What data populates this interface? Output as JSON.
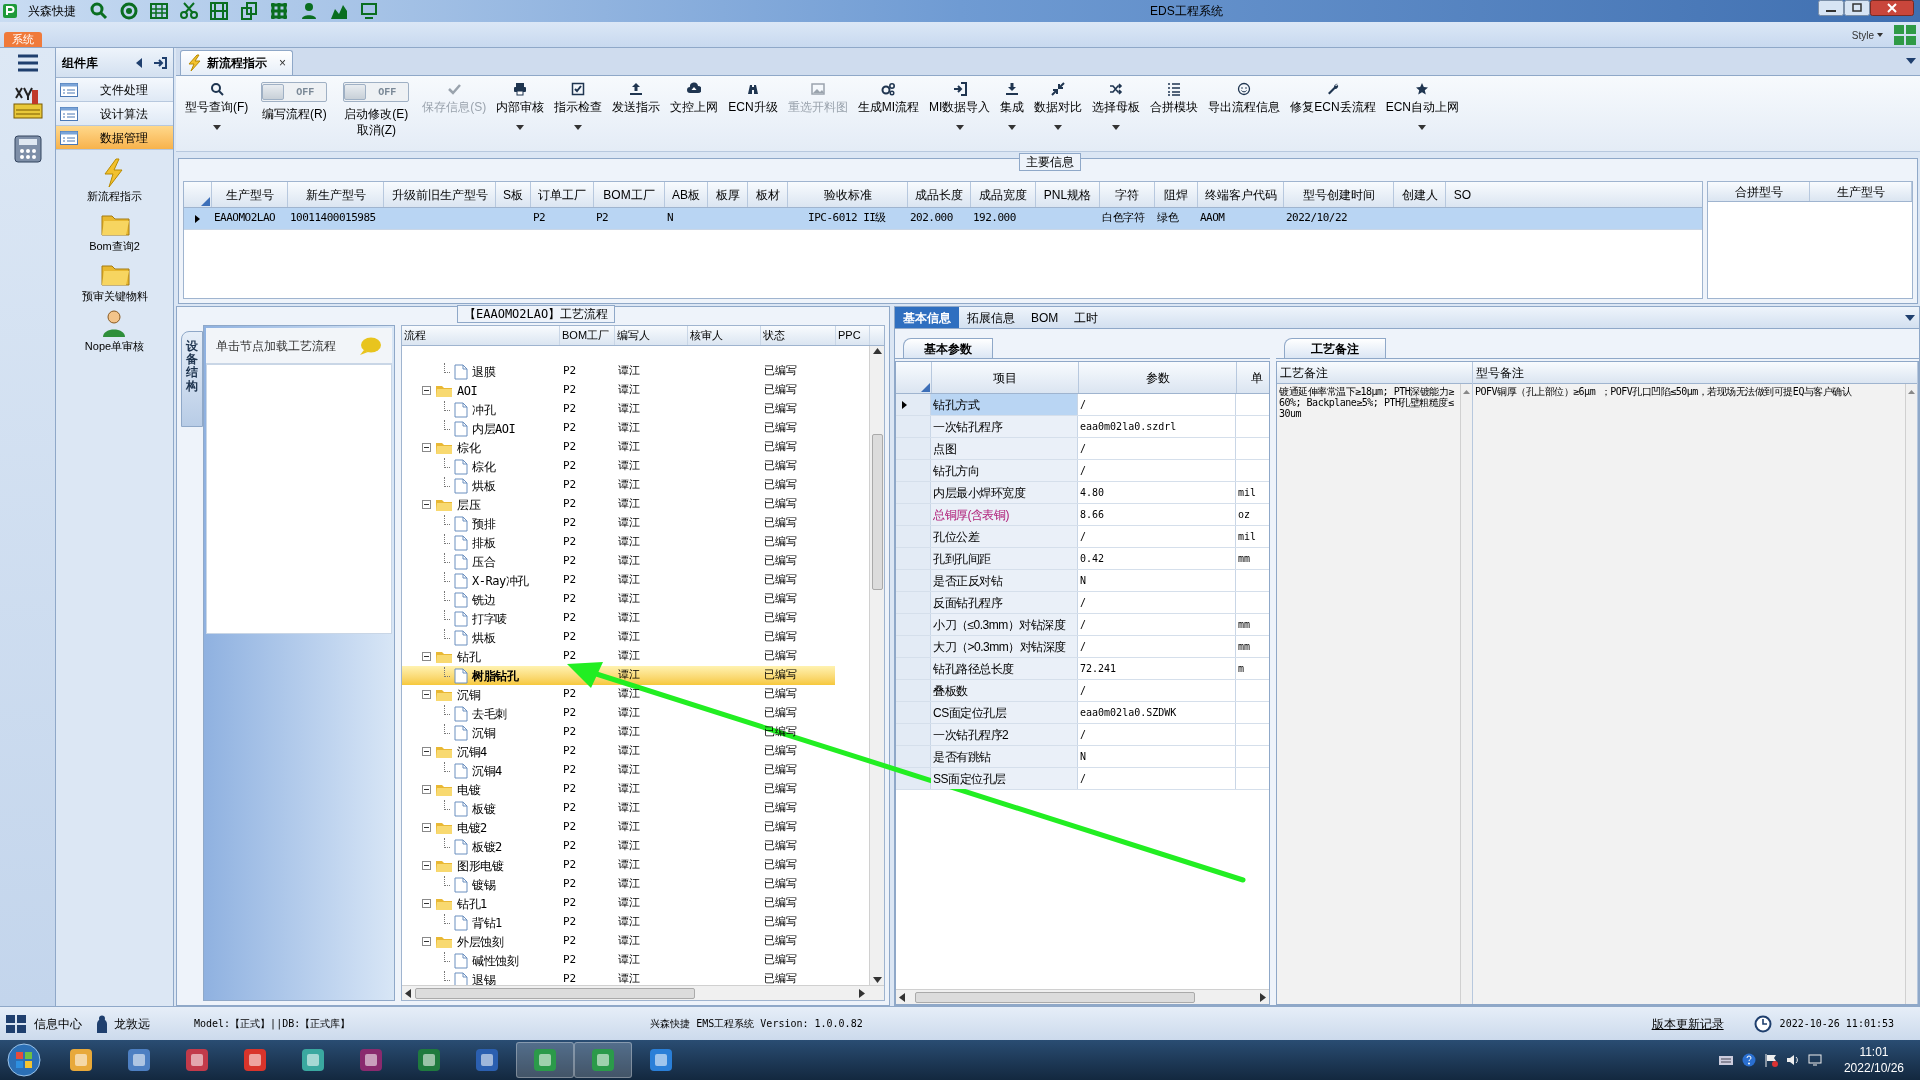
{
  "window": {
    "app_name": "兴森快捷",
    "title": "EDS工程系统"
  },
  "ribbon": {
    "tab": "系统",
    "style_menu": "Style"
  },
  "component_library": {
    "title": "组件库",
    "items": [
      {
        "label": "文件处理",
        "selected": false
      },
      {
        "label": "设计算法",
        "selected": false
      },
      {
        "label": "数据管理",
        "selected": true
      }
    ],
    "launchers": [
      {
        "label": "新流程指示"
      },
      {
        "label": "Bom查询2"
      },
      {
        "label": "预审关键物料"
      },
      {
        "label": "Nope单审核"
      }
    ]
  },
  "document_tab": {
    "label": "新流程指示",
    "close": "×"
  },
  "toolbar": [
    {
      "kind": "button",
      "label": "型号查询(F)",
      "dropdown": true,
      "disabled": false
    },
    {
      "kind": "toggle",
      "switch_text": "OFF",
      "on": false,
      "label": "编写流程(R)"
    },
    {
      "kind": "toggle",
      "switch_text": "OFF",
      "on": false,
      "label": "启动修改(E)",
      "sublabel": "取消(Z)"
    },
    {
      "kind": "button",
      "label": "保存信息(S)",
      "dropdown": false,
      "disabled": true
    },
    {
      "kind": "button",
      "label": "内部审核",
      "dropdown": true,
      "disabled": false
    },
    {
      "kind": "button",
      "label": "指示检查",
      "dropdown": true,
      "disabled": false
    },
    {
      "kind": "button",
      "label": "发送指示",
      "dropdown": false,
      "disabled": false
    },
    {
      "kind": "button",
      "label": "文控上网",
      "dropdown": false,
      "disabled": false
    },
    {
      "kind": "button",
      "label": "ECN升级",
      "dropdown": false,
      "disabled": false
    },
    {
      "kind": "button",
      "label": "重选开料图",
      "dropdown": false,
      "disabled": true
    },
    {
      "kind": "button",
      "label": "生成MI流程",
      "dropdown": false,
      "disabled": false
    },
    {
      "kind": "button",
      "label": "MI数据导入",
      "dropdown": true,
      "disabled": false
    },
    {
      "kind": "button",
      "label": "集成",
      "dropdown": true,
      "disabled": false
    },
    {
      "kind": "button",
      "label": "数据对比",
      "dropdown": true,
      "disabled": false
    },
    {
      "kind": "button",
      "label": "选择母板",
      "dropdown": true,
      "disabled": false
    },
    {
      "kind": "button",
      "label": "合拼模块",
      "dropdown": false,
      "disabled": false
    },
    {
      "kind": "button",
      "label": "导出流程信息",
      "dropdown": false,
      "disabled": false
    },
    {
      "kind": "button",
      "label": "修复ECN丢流程",
      "dropdown": false,
      "disabled": false
    },
    {
      "kind": "button",
      "label": "ECN自动上网",
      "dropdown": true,
      "disabled": false
    }
  ],
  "main_info": {
    "title": "主要信息",
    "columns": [
      "生产型号",
      "新生产型号",
      "升级前旧生产型号",
      "S板",
      "订单工厂",
      "BOM工厂",
      "AB板",
      "板厚",
      "板材",
      "验收标准",
      "成品长度",
      "成品宽度",
      "PNL规格",
      "字符",
      "阻焊",
      "终端客户代码",
      "型号创建时间",
      "创建人",
      "SO"
    ],
    "rows": [
      {
        "selected": true,
        "cells": {
          "0": "EAAOMO2LAO",
          "1": "10011400015985",
          "4": "P2",
          "5": "P2",
          "6": "N",
          "9": "IPC-6012 II级",
          "10": "202.000",
          "11": "192.000",
          "13": "白色字符",
          "14": "绿色",
          "15": "AAOM",
          "16": "2022/10/22"
        }
      }
    ],
    "merge_columns": [
      "合拼型号",
      "生产型号"
    ]
  },
  "process_panel": {
    "title": "【EAAOMO2LAO】工艺流程",
    "side_tab": "设备结构",
    "hint": "单击节点加载工艺流程",
    "columns": [
      "流程",
      "BOM工厂",
      "编写人",
      "核审人",
      "状态",
      "PPC"
    ],
    "tree": [
      {
        "children": [
          {
            "label": "退膜",
            "bom": "P2",
            "writer": "谭江",
            "status": "已编写",
            "selected": false
          }
        ]
      },
      {
        "label": "AOI",
        "bom": "P2",
        "writer": "谭江",
        "status": "已编写",
        "selected": false,
        "expanded": true,
        "children": [
          {
            "label": "冲孔",
            "bom": "P2",
            "writer": "谭江",
            "status": "已编写",
            "selected": false
          },
          {
            "label": "内层AOI",
            "bom": "P2",
            "writer": "谭江",
            "status": "已编写",
            "selected": false
          }
        ]
      },
      {
        "label": "棕化",
        "bom": "P2",
        "writer": "谭江",
        "status": "已编写",
        "selected": false,
        "expanded": true,
        "children": [
          {
            "label": "棕化",
            "bom": "P2",
            "writer": "谭江",
            "status": "已编写",
            "selected": false
          },
          {
            "label": "烘板",
            "bom": "P2",
            "writer": "谭江",
            "status": "已编写",
            "selected": false
          }
        ]
      },
      {
        "label": "层压",
        "bom": "P2",
        "writer": "谭江",
        "status": "已编写",
        "selected": false,
        "expanded": true,
        "children": [
          {
            "label": "预排",
            "bom": "P2",
            "writer": "谭江",
            "status": "已编写",
            "selected": false
          },
          {
            "label": "排板",
            "bom": "P2",
            "writer": "谭江",
            "status": "已编写",
            "selected": false
          },
          {
            "label": "压合",
            "bom": "P2",
            "writer": "谭江",
            "status": "已编写",
            "selected": false
          },
          {
            "label": "X-Ray冲孔",
            "bom": "P2",
            "writer": "谭江",
            "status": "已编写",
            "selected": false
          },
          {
            "label": "铣边",
            "bom": "P2",
            "writer": "谭江",
            "status": "已编写",
            "selected": false
          },
          {
            "label": "打字唛",
            "bom": "P2",
            "writer": "谭江",
            "status": "已编写",
            "selected": false
          },
          {
            "label": "烘板",
            "bom": "P2",
            "writer": "谭江",
            "status": "已编写",
            "selected": false
          }
        ]
      },
      {
        "label": "钻孔",
        "bom": "P2",
        "writer": "谭江",
        "status": "已编写",
        "selected": false,
        "expanded": true,
        "children": [
          {
            "label": "树脂钻孔",
            "writer": "谭江",
            "status": "已编写",
            "selected": true
          }
        ]
      },
      {
        "label": "沉铜",
        "bom": "P2",
        "writer": "谭江",
        "status": "已编写",
        "selected": false,
        "expanded": true,
        "children": [
          {
            "label": "去毛刺",
            "bom": "P2",
            "writer": "谭江",
            "status": "已编写",
            "selected": false
          },
          {
            "label": "沉铜",
            "bom": "P2",
            "writer": "谭江",
            "status": "已编写",
            "selected": false
          }
        ]
      },
      {
        "label": "沉铜4",
        "bom": "P2",
        "writer": "谭江",
        "status": "已编写",
        "selected": false,
        "expanded": true,
        "children": [
          {
            "label": "沉铜4",
            "bom": "P2",
            "writer": "谭江",
            "status": "已编写",
            "selected": false
          }
        ]
      },
      {
        "label": "电镀",
        "bom": "P2",
        "writer": "谭江",
        "status": "已编写",
        "selected": false,
        "expanded": true,
        "children": [
          {
            "label": "板镀",
            "bom": "P2",
            "writer": "谭江",
            "status": "已编写",
            "selected": false
          }
        ]
      },
      {
        "label": "电镀2",
        "bom": "P2",
        "writer": "谭江",
        "status": "已编写",
        "selected": false,
        "expanded": true,
        "children": [
          {
            "label": "板镀2",
            "bom": "P2",
            "writer": "谭江",
            "status": "已编写",
            "selected": false
          }
        ]
      },
      {
        "label": "图形电镀",
        "bom": "P2",
        "writer": "谭江",
        "status": "已编写",
        "selected": false,
        "expanded": true,
        "children": [
          {
            "label": "镀锡",
            "bom": "P2",
            "writer": "谭江",
            "status": "已编写",
            "selected": false
          }
        ]
      },
      {
        "label": "钻孔1",
        "bom": "P2",
        "writer": "谭江",
        "status": "已编写",
        "selected": false,
        "expanded": true,
        "children": [
          {
            "label": "背钻1",
            "bom": "P2",
            "writer": "谭江",
            "status": "已编写",
            "selected": false
          }
        ]
      },
      {
        "label": "外层蚀刻",
        "bom": "P2",
        "writer": "谭江",
        "status": "已编写",
        "selected": false,
        "expanded": true,
        "children": [
          {
            "label": "碱性蚀刻",
            "bom": "P2",
            "writer": "谭江",
            "status": "已编写",
            "selected": false
          },
          {
            "label": "退锡",
            "bom": "P2",
            "writer": "谭江",
            "status": "已编写",
            "selected": false
          }
        ]
      }
    ]
  },
  "detail_tabs": [
    {
      "label": "基本信息",
      "selected": true
    },
    {
      "label": "拓展信息",
      "selected": false
    },
    {
      "label": "BOM",
      "selected": false
    },
    {
      "label": "工时",
      "selected": false
    }
  ],
  "basic_params": {
    "tab": "基本参数",
    "columns": [
      "项目",
      "参数",
      "单"
    ],
    "rows": [
      {
        "item": "钻孔方式",
        "value": "/",
        "selected": true,
        "emphasized": false
      },
      {
        "item": "一次钻孔程序",
        "value": "eaa0m02la0.szdrl",
        "selected": false,
        "emphasized": false
      },
      {
        "item": "点图",
        "value": "/",
        "selected": false,
        "emphasized": false
      },
      {
        "item": "钻孔方向",
        "value": "/",
        "selected": false,
        "emphasized": false
      },
      {
        "item": "内层最小焊环宽度",
        "value": "4.80",
        "unit": "mil",
        "selected": false,
        "emphasized": false
      },
      {
        "item": "总铜厚(含表铜)",
        "value": "8.66",
        "unit": "oz",
        "selected": false,
        "emphasized": true
      },
      {
        "item": "孔位公差",
        "value": "/",
        "unit": "mil",
        "selected": false,
        "emphasized": false
      },
      {
        "item": "孔到孔间距",
        "value": "0.42",
        "unit": "mm",
        "selected": false,
        "emphasized": false
      },
      {
        "item": "是否正反对钻",
        "value": "N",
        "selected": false,
        "emphasized": false
      },
      {
        "item": "反面钻孔程序",
        "value": "/",
        "selected": false,
        "emphasized": false
      },
      {
        "item": "小刀（≤0.3mm）对钻深度",
        "value": "/",
        "unit": "mm",
        "selected": false,
        "emphasized": false
      },
      {
        "item": "大刀（>0.3mm）对钻深度",
        "value": "/",
        "unit": "mm",
        "selected": false,
        "emphasized": false
      },
      {
        "item": "钻孔路径总长度",
        "value": "72.241",
        "unit": "m",
        "selected": false,
        "emphasized": false
      },
      {
        "item": "叠板数",
        "value": "/",
        "selected": false,
        "emphasized": false
      },
      {
        "item": "CS面定位孔层",
        "value": "eaa0m02la0.SZDWK",
        "selected": false,
        "emphasized": false
      },
      {
        "item": "一次钻孔程序2",
        "value": "/",
        "selected": false,
        "emphasized": false
      },
      {
        "item": "是否有跳钻",
        "value": "N",
        "selected": false,
        "emphasized": false
      },
      {
        "item": "SS面定位孔层",
        "value": "/",
        "selected": false,
        "emphasized": false
      }
    ]
  },
  "remarks": {
    "tab": "工艺备注",
    "columns": [
      "工艺备注",
      "型号备注"
    ],
    "process_remark": "镀通延伸率常温下≥18μm; PTH深镀能力≥60%; Backplane≥5%; PTH孔壁粗糙度≤30um",
    "model_remark": "POFV铜厚（孔上部位）≥6μm ；POFV孔口凹陷≤50μm，若现场无法做到可提EQ与客户确认"
  },
  "status_bar": {
    "info_center": "信息中心",
    "user": "龙敦远",
    "environment": "Model:【正式】||DB:【正式库】",
    "version": "兴森快捷 EMS工程系统 Version: 1.0.0.82",
    "changelog": "版本更新记录",
    "datetime": "2022-10-26 11:01:53"
  },
  "taskbar": {
    "time": "11:01",
    "date": "2022/10/26"
  }
}
